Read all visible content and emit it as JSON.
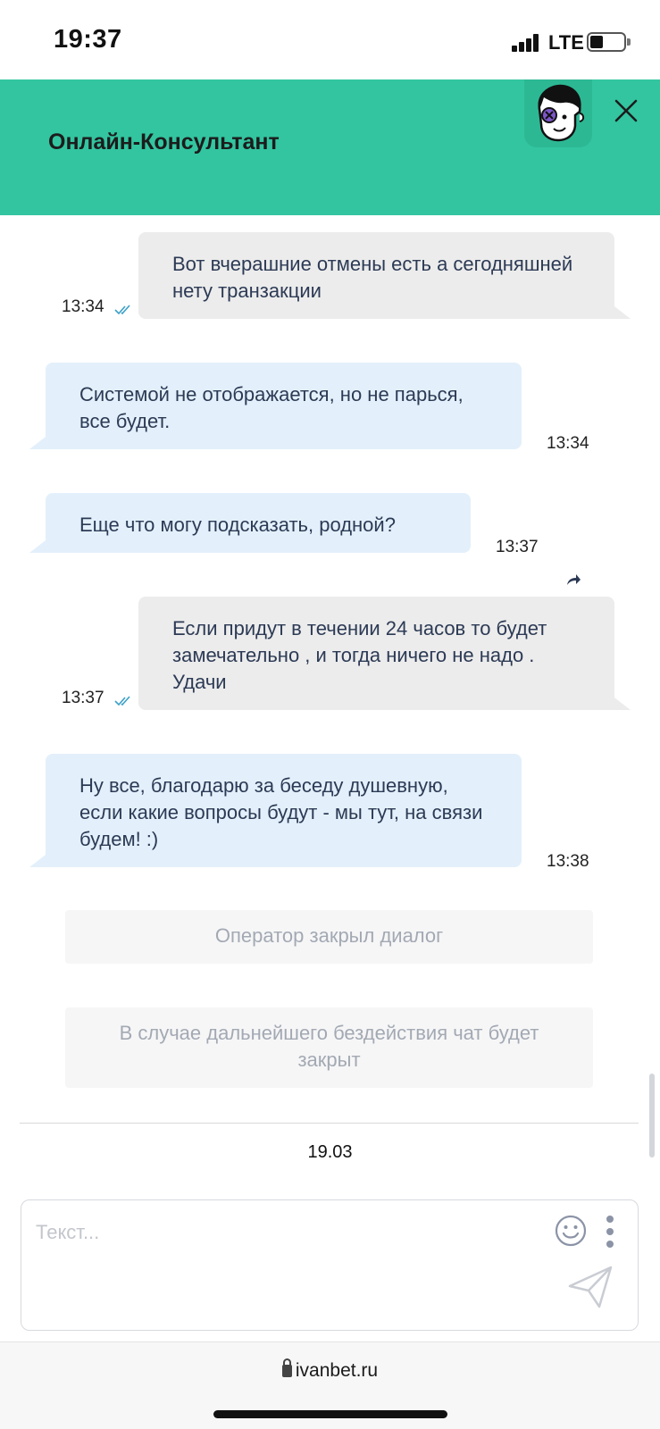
{
  "status_bar": {
    "time": "19:37",
    "network": "LTE"
  },
  "header": {
    "title": "Онлайн-Консультант",
    "avatar_icon": "operator-face-icon",
    "close_icon": "close-icon"
  },
  "messages": [
    {
      "sender": "user",
      "text": "Вот вчерашние отмены есть а сегодняшней нету транзакции",
      "time": "13:34",
      "read": true
    },
    {
      "sender": "operator",
      "text": "Системой не отображается, но не парься, все будет.",
      "time": "13:34"
    },
    {
      "sender": "operator",
      "text": "Еще что могу подсказать, родной?",
      "time": "13:37"
    },
    {
      "sender": "user",
      "text": "Если придут в течении 24 часов то будет замечательно , и тогда ничего не надо . Удачи",
      "time": "13:37",
      "read": true
    },
    {
      "sender": "operator",
      "text": "Ну все, благодарю за беседу душевную, если какие вопросы будут - мы тут, на связи будем! :)",
      "time": "13:38"
    }
  ],
  "system_notices": [
    "Оператор закрыл диалог",
    "В случае дальнейшего бездействия чат будет закрыт"
  ],
  "date_divider": "19.03",
  "composer": {
    "placeholder": "Текст...",
    "emoji_icon": "emoji-icon",
    "menu_icon": "more-vertical-icon",
    "send_icon": "send-icon"
  },
  "browser": {
    "url": "ivanbet.ru",
    "lock_icon": "lock-icon"
  },
  "colors": {
    "header_bg": "#32c5a0",
    "user_bubble": "#ececec",
    "operator_bubble": "#e3f0fb",
    "read_ticks": "#3aa0c8"
  }
}
